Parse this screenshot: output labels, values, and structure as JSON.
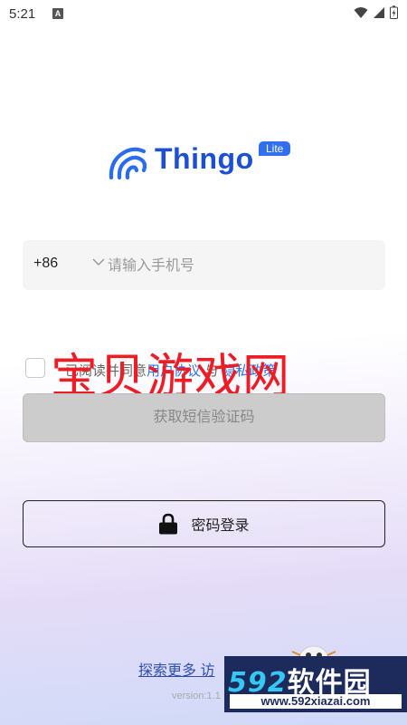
{
  "status_bar": {
    "time": "5:21",
    "notification_letter": "A"
  },
  "logo": {
    "brand": "Thingo",
    "badge": "Lite"
  },
  "phone": {
    "country_code": "+86",
    "placeholder": "请输入手机号"
  },
  "agreement": {
    "prefix": "已阅读并同意",
    "user_agreement": "用户协议",
    "conjunction": "与",
    "privacy_policy": "隐私政策"
  },
  "watermark_text": "宝贝游戏网",
  "buttons": {
    "get_code": "获取短信验证码",
    "password_login": "密码登录"
  },
  "footer": {
    "explore": "探索更多 访",
    "version": "version:1.1"
  },
  "site_watermark": {
    "numbers": "592",
    "name": "软件园",
    "url": "www.592xiazai.com"
  },
  "colors": {
    "brand_blue": "#1b4fd6",
    "link_blue": "#2f6ff0",
    "watermark_red": "#ee1c25"
  }
}
